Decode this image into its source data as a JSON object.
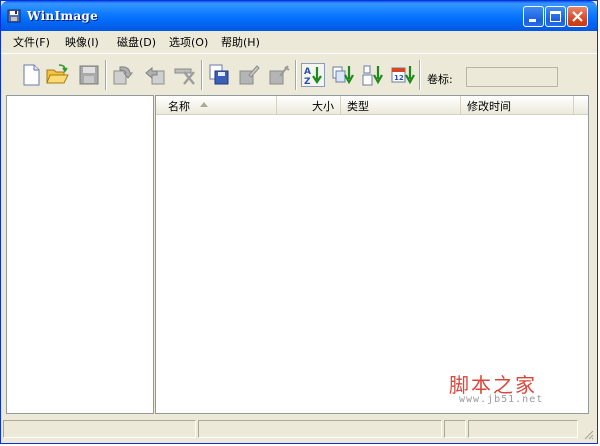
{
  "window": {
    "title": "WinImage",
    "icon": "floppy-disk-icon",
    "controls": [
      "minimize",
      "maximize",
      "close"
    ]
  },
  "menu": [
    {
      "label": "文件(F)"
    },
    {
      "label": "映像(I)"
    },
    {
      "label": "磁盘(D)"
    },
    {
      "label": "选项(O)"
    },
    {
      "label": "帮助(H)"
    }
  ],
  "toolbar": {
    "buttons": [
      {
        "icon": "new-file-icon",
        "enabled": true
      },
      {
        "icon": "open-folder-icon",
        "enabled": true
      },
      {
        "icon": "save-icon",
        "enabled": false
      },
      {
        "icon": "extract-icon",
        "enabled": false
      },
      {
        "icon": "inject-icon",
        "enabled": false
      },
      {
        "icon": "delete-icon",
        "enabled": false
      },
      {
        "icon": "read-disk-icon",
        "enabled": true
      },
      {
        "icon": "write-disk-icon",
        "enabled": false
      },
      {
        "icon": "format-disk-icon",
        "enabled": false
      },
      {
        "icon": "sort-by-name-icon",
        "enabled": true
      },
      {
        "icon": "sort-by-type-icon",
        "enabled": true
      },
      {
        "icon": "sort-by-size-icon",
        "enabled": true
      },
      {
        "icon": "sort-by-date-icon",
        "enabled": true
      }
    ],
    "volume_label": "卷标:",
    "volume_value": ""
  },
  "list": {
    "columns": [
      {
        "label": "名称",
        "sorted": "ascending"
      },
      {
        "label": "大小"
      },
      {
        "label": "类型"
      },
      {
        "label": "修改时间"
      }
    ],
    "rows": []
  },
  "watermark": {
    "main": "脚本之家",
    "sub": "www.jb51.net"
  },
  "status": {
    "panes": [
      "",
      "",
      "",
      ""
    ]
  },
  "colors": {
    "titlebar": "#0058ee",
    "close_button": "#d2431c",
    "chrome": "#ece9d8",
    "watermark": "#d8473a"
  }
}
